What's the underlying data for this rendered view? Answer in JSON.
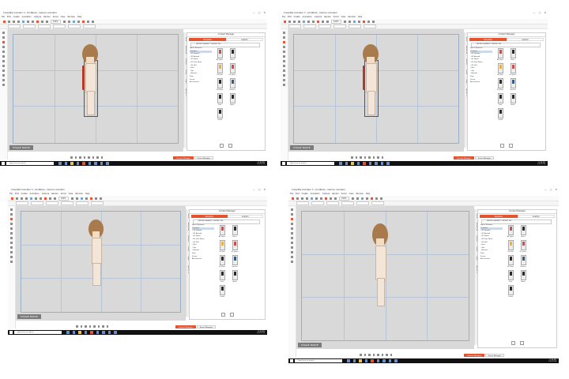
{
  "window": {
    "title": "CrazyTalk Animator 3 - [Untitled] - Cartoon Animator",
    "controls": [
      "—",
      "▢",
      "✕"
    ]
  },
  "menu": [
    "File",
    "Edit",
    "Create",
    "Animation",
    "Camera",
    "Render",
    "Script",
    "View",
    "Window",
    "Help"
  ],
  "toolbar": {
    "zoom": "100%"
  },
  "canvas": {
    "stage_mode_label": "STAGE MODE"
  },
  "panel": {
    "title": "Content Manager",
    "tabs": [
      "Template",
      "Custom"
    ],
    "combo": "SPRITE ELEMENT CONTENT SET",
    "tree": [
      "Sprite Element",
      "Costume",
      "- G3 Human",
      "- G3 Animal",
      "- G3 Spine",
      "- G3 Free Bone",
      "- G3 Hat",
      "- Hair",
      "- Top",
      "- Bottom",
      "Prop",
      "Scene",
      "Accessories"
    ],
    "thumbs": [
      "All Styles",
      "Shoes",
      "G3_Shirt",
      "G3_Jacket",
      "G3_Pants",
      "Sweater",
      "Coat",
      "Boots",
      "Casual"
    ],
    "side_tabs": [
      "Actor",
      "Animation",
      "Camera",
      "Scene",
      "Props",
      "Special FX"
    ]
  },
  "bottom_tabs": [
    "Content Manager",
    "Scene Manager"
  ],
  "taskbar": {
    "search_placeholder": "Type here to search",
    "time": "11:44 AM",
    "date": "1/31/2018"
  },
  "colors": {
    "accent": "#e5532f",
    "canvas_bg": "#d9d9d9",
    "taskbar": "#111111"
  }
}
